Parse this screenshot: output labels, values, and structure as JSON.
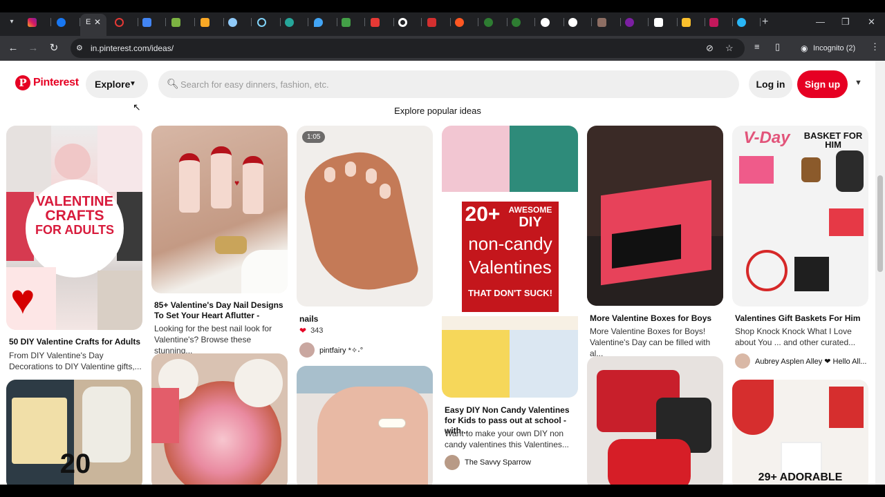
{
  "browser": {
    "url": "in.pinterest.com/ideas/",
    "active_tab_title": "E",
    "profile_label": "Incognito (2)",
    "new_tab_label": "+"
  },
  "header": {
    "logo_text": "Pinterest",
    "explore_label": "Explore",
    "search_placeholder": "Search for easy dinners, fashion, etc.",
    "login_label": "Log in",
    "signup_label": "Sign up"
  },
  "page_heading": "Explore popular ideas",
  "pins": {
    "crafts": {
      "title": "50 DIY Valentine Crafts for Adults",
      "desc": "From DIY Valentine's Day Decorations to DIY Valentine gifts,...",
      "overlay_line1": "VALENTINE",
      "overlay_line2": "CRAFTS",
      "overlay_line3": "FOR ADULTS"
    },
    "nails": {
      "title": "85+ Valentine's Day Nail Designs To Set Your Heart Aflutter -",
      "desc": "Looking for the best nail look for Valentine's? Browse these stunning..."
    },
    "nails_video": {
      "duration": "1:05",
      "title": "nails",
      "likes": "343",
      "author": "pintfairy *✧˖°"
    },
    "non_candy": {
      "title": "Easy DIY Non Candy Valentines for Kids to pass out at school - with...",
      "desc": "Want to make your own DIY non candy valentines this Valentines...",
      "author": "The Savvy Sparrow",
      "overlay_line1": "20+",
      "overlay_line2": "AWESOME",
      "overlay_line3": "DIY",
      "overlay_line4": "non-candy",
      "overlay_line5": "Valentines",
      "overlay_line6": "THAT DON'T SUCK!"
    },
    "boxes": {
      "title": "More Valentine Boxes for Boys",
      "desc": "More Valentine Boxes for Boys! Valentine's Day can be filled with al..."
    },
    "basket": {
      "title": "Valentines Gift Baskets For Him",
      "desc": "Shop Knock Knock What I Love about You ... and other curated...",
      "author": "Aubrey Asplen Alley ❤ Hello All...",
      "overlay_line1": "V-Day",
      "overlay_line2": "BASKET FOR HIM"
    },
    "jar": {
      "overlay": "20"
    },
    "adorable": {
      "overlay": "29+ ADORABLE"
    }
  },
  "colors": {
    "brand": "#e60023",
    "chrome_dark": "#202124",
    "chrome_toolbar": "#35363a"
  },
  "icons": {
    "back": "arrow-left",
    "forward": "arrow-right",
    "reload": "reload",
    "search": "magnifier",
    "explore_chevron": "chevron-down"
  }
}
